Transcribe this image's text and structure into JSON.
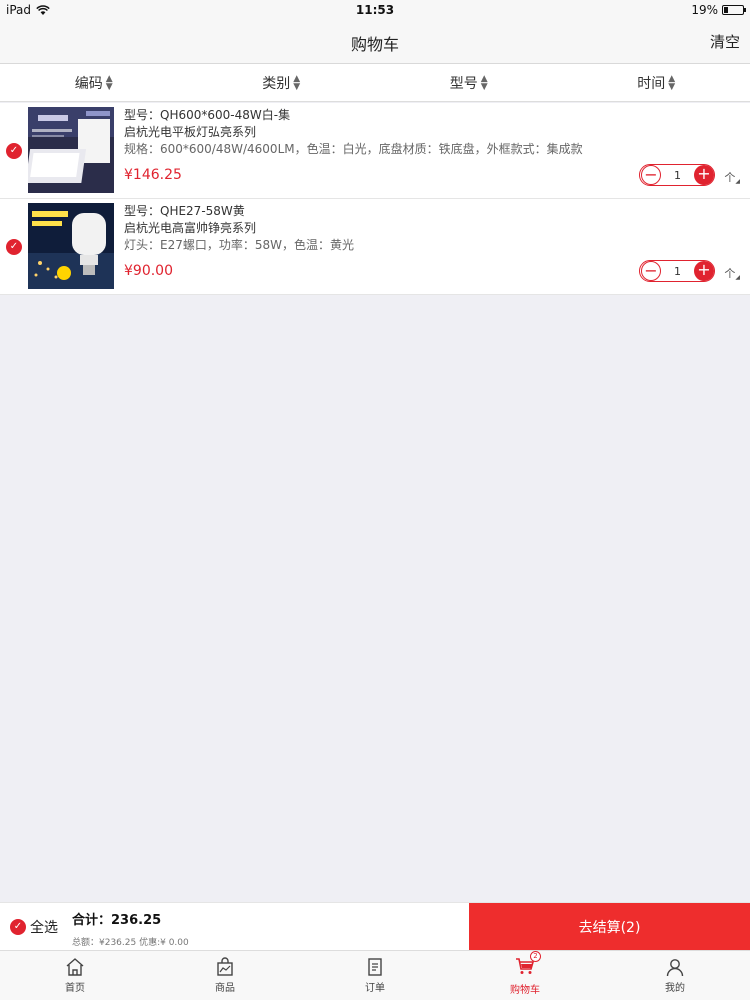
{
  "status_bar": {
    "device": "iPad",
    "time": "11:53",
    "battery": "19%",
    "battery_level": 0.19
  },
  "nav": {
    "title": "购物车",
    "clear_label": "清空"
  },
  "sort_bar": {
    "items": [
      {
        "label": "编码"
      },
      {
        "label": "类别"
      },
      {
        "label": "型号"
      },
      {
        "label": "时间"
      }
    ]
  },
  "cart_items": [
    {
      "model": "型号：QH600*600-48W白-集",
      "series": "启杭光电平板灯弘亮系列",
      "spec": "规格：600*600/48W/4600LM，色温：白光，底盘材质：铁底盘，外框款式：集成款",
      "price": "¥146.25",
      "quantity": "1",
      "unit": "个",
      "checked": true
    },
    {
      "model": "型号：QHE27-58W黄",
      "series": "启杭光电高富帅铮亮系列",
      "spec": "灯头：E27螺口，功率：58W，色温：黄光",
      "price": "¥90.00",
      "quantity": "1",
      "unit": "个",
      "checked": true
    }
  ],
  "bottom_bar": {
    "select_all_label": "全选",
    "total_label": "合计：236.25",
    "detail": "总额：¥236.25 优惠:¥ 0.00",
    "checkout_label": "去结算(2)"
  },
  "tab_bar": {
    "items": [
      {
        "label": "首页",
        "icon": "home-icon"
      },
      {
        "label": "商品",
        "icon": "shopping-bag-icon"
      },
      {
        "label": "订单",
        "icon": "order-list-icon"
      },
      {
        "label": "购物车",
        "icon": "cart-icon",
        "badge": "2"
      },
      {
        "label": "我的",
        "icon": "user-icon"
      }
    ],
    "active_index": 3
  },
  "colors": {
    "accent": "#e0232f",
    "checkout": "#ee2d2d",
    "background": "#efeff4"
  }
}
